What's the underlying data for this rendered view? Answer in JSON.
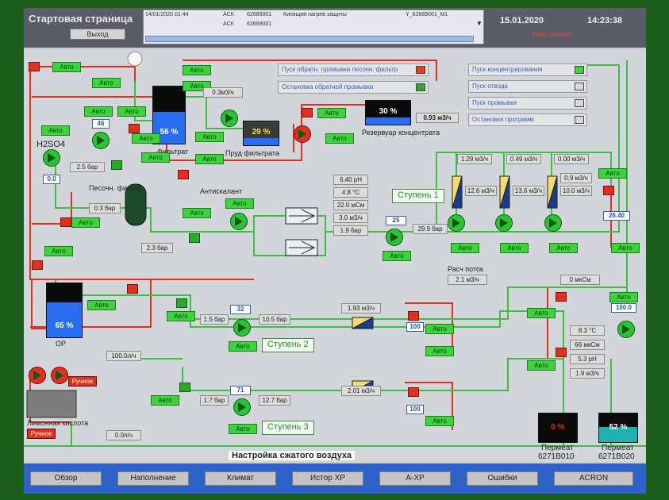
{
  "header": {
    "title": "Стартовая страница",
    "exit_button": "Выход",
    "date": "15.01.2020",
    "time": "14:23:38",
    "alarm_status": "Квит сигнал",
    "alarms": [
      {
        "time": "14/01/2020 01:44",
        "source": "АСК",
        "id": "62689001",
        "text": "Кипящий нагрев защиты",
        "tag": "Y_62689001_M1"
      },
      {
        "time": "",
        "source": "АСК",
        "id": "62689001",
        "text": "",
        "tag": ""
      }
    ]
  },
  "menu": {
    "left": [
      {
        "label": "Пуск обратн. промывки песочн. фильтр",
        "state": "red"
      },
      {
        "label": "Остановка обратной промывки",
        "state": "grn"
      }
    ],
    "right": [
      {
        "label": "Пуск концентрирования",
        "state": "on"
      },
      {
        "label": "Пуск отвода",
        "state": "off"
      },
      {
        "label": "Пуск промывки",
        "state": "off"
      },
      {
        "label": "Остановка программ",
        "state": "off"
      }
    ]
  },
  "auto_label": "Авто",
  "manual_label": "Ручное",
  "labels": {
    "filtrat": "Фильтрат",
    "prud_filtrata": "Пруд фильтрата",
    "rezervuar": "Резервуар концентрата",
    "h2so4": "H2SO4",
    "pesochnyi_filtr": "Песочн. фильтр",
    "antiskalant": "Антискалант",
    "op": "OP",
    "limonnaya": "Лимонная кислота",
    "raskhod_potok": "Расч поток",
    "stage1": "Ступень 1",
    "stage2": "Ступень 2",
    "stage3": "Ступень 3",
    "compressed_air": "Настройка сжатого воздуха",
    "permeat1": "Пермеат",
    "permeat1_code": "6271B010",
    "permeat2": "Пермеат",
    "permeat2_code": "6271B020"
  },
  "tanks": {
    "filtrat_pct": "56 %",
    "prud_pct": "29 %",
    "rezervuar_pct": "30 %",
    "op_pct": "65 %",
    "perm1_pct": "0 %",
    "perm2_pct": "52 %"
  },
  "values": {
    "flow_top": "0.3м3/ч",
    "flow_rez": "0.93 м3/ч",
    "h2so4_sp": "46",
    "h2so4_val": "0.0",
    "p_25": "2.5 бар",
    "p_03": "0.3 бар",
    "p_23": "2.3 бар",
    "ph": "6.40 pH",
    "temp": "4.8 °C",
    "cond": "22.0 мСм",
    "flow3": "3.0 м3/ч",
    "p_19": "1.9 бар",
    "pump_sp": "25",
    "p_299": "29.9 бар",
    "f1": "1.29 м3/ч",
    "f2": "0.49 м3/ч",
    "f3": "0.00 м3/ч",
    "f4": "12.6 м3/ч",
    "f5": "13.6 м3/ч",
    "f6": "10.0 м3/ч",
    "f7": "0.9 м3/ч",
    "valve1": "26.40",
    "raschet": "2.1 м3/ч",
    "mksm": "0 мкСм",
    "s2_sp": "32",
    "p_15": "1.5 бар",
    "p_105": "10.5 бар",
    "f_193": "1.93 м3/ч",
    "s2_valve": "100",
    "pump_right": "100.0",
    "t_83": "8.3 °C",
    "cond_66": "66 мкСм",
    "ph_53": "5.3 pH",
    "f_19": "1.9 м3/ч",
    "flow_100": "100.0л/ч",
    "s3_sp": "71",
    "p_17": "1.7 бар",
    "p_127": "12.7 бар",
    "f_201": "2.01 м3/ч",
    "s3_valve": "100",
    "flow_0": "0.0л/ч"
  },
  "nav": [
    "Обзор",
    "Наполнение",
    "Климат",
    "Истор ХР",
    "А-ХР",
    "Ошибки",
    "ACRON"
  ],
  "colors": {
    "auto": "#3fd23f",
    "pipe_red": "#e03020",
    "pipe_green": "#3fbf3f",
    "nav": "#2f62c9"
  }
}
